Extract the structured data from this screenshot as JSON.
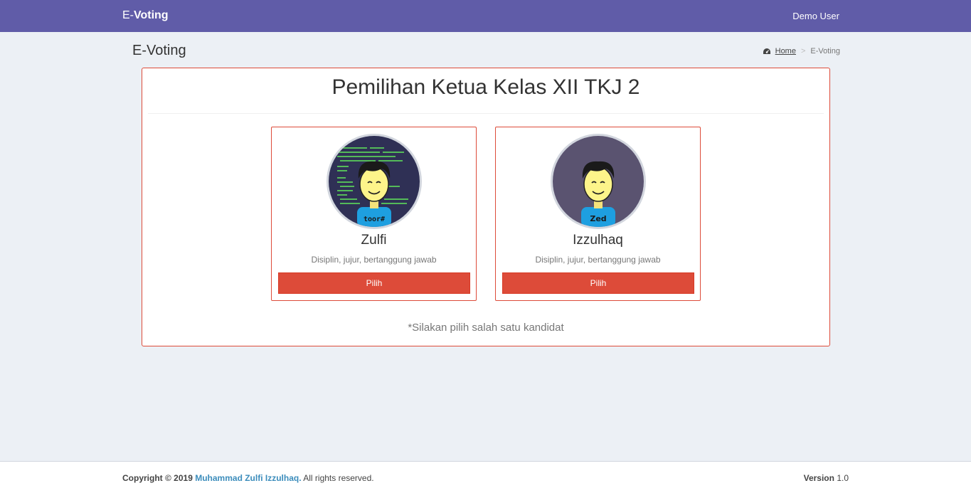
{
  "navbar": {
    "brand_prefix": "E-",
    "brand_bold": "Voting",
    "user": "Demo User",
    "color": "#605ca8"
  },
  "header": {
    "title": "E-Voting",
    "breadcrumb": {
      "home": "Home",
      "separator": ">",
      "current": "E-Voting"
    }
  },
  "election": {
    "title": "Pemilihan Ketua Kelas XII TKJ 2",
    "note": "*Silakan pilih salah satu kandidat",
    "accent": "#dd4b39",
    "candidates": [
      {
        "name": "Zulfi",
        "motto": "Disiplin, jujur, bertanggung jawab",
        "button": "Pilih",
        "shirt_label": "toor#",
        "avatar_icon": "coder-avatar-icon"
      },
      {
        "name": "Izzulhaq",
        "motto": "Disiplin, jujur, bertanggung jawab",
        "button": "Pilih",
        "shirt_label": "Zed",
        "avatar_icon": "person-avatar-icon"
      }
    ]
  },
  "footer": {
    "copyright_prefix": "Copyright © 2019",
    "author": "Muhammad Zulfi Izzulhaq.",
    "rights": "All rights reserved.",
    "version_label": "Version",
    "version_number": "1.0"
  }
}
